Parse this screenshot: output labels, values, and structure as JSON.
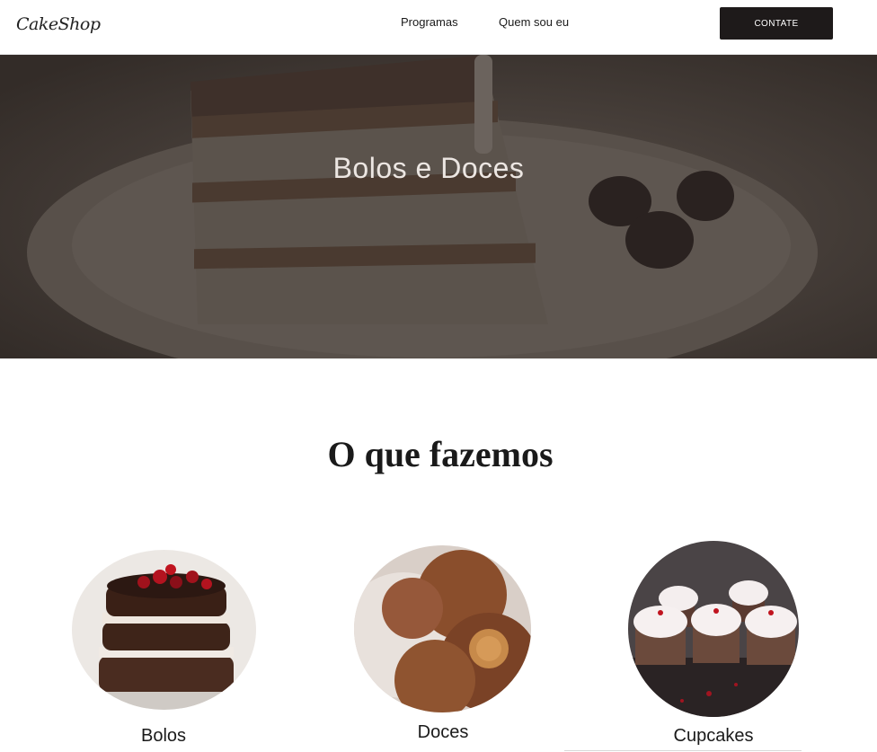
{
  "header": {
    "logo": "CakeShop",
    "nav": [
      "Programas",
      "Quem sou eu"
    ],
    "contact_label": "CONTATE"
  },
  "hero": {
    "title": "Bolos e Doces",
    "image_icon": "tiramisu-cake-photo"
  },
  "section": {
    "title": "O que fazemos",
    "items": [
      {
        "label": "Bolos",
        "image_icon": "layered-cake-photo"
      },
      {
        "label": "Doces",
        "image_icon": "brigadeiro-photo"
      },
      {
        "label": "Cupcakes",
        "image_icon": "cupcakes-photo"
      }
    ]
  },
  "colors": {
    "button_bg": "#1e1a1a",
    "hero_overlay": "#3d3632",
    "text": "#1a1a1a"
  }
}
